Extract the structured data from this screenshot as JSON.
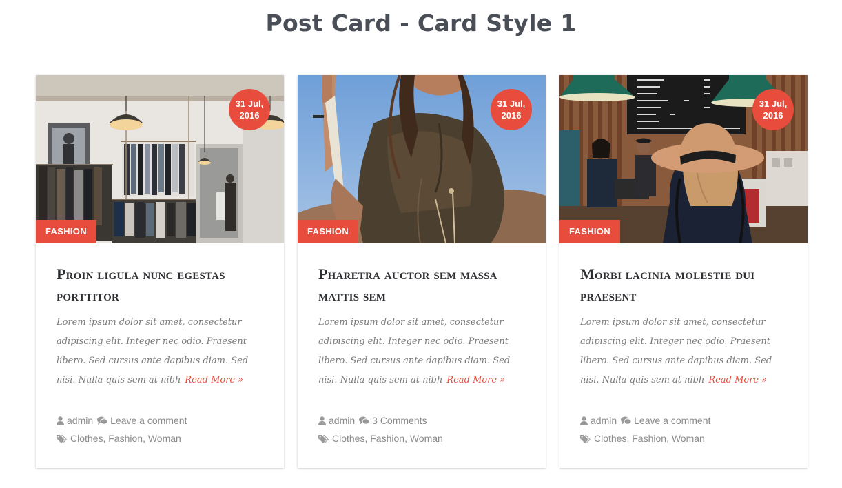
{
  "page": {
    "title": "Post Card - Card Style 1"
  },
  "colors": {
    "accent": "#e84c3d",
    "title": "#4a4e57",
    "text": "#7a7a7a"
  },
  "cards": [
    {
      "image": "clothing-store-photo",
      "date_line1": "31 Jul,",
      "date_line2": "2016",
      "category": "FASHION",
      "title": "Proin ligula nunc egestas porttitor",
      "excerpt": "Lorem ipsum dolor sit amet, consectetur adipiscing elit. Integer nec odio. Praesent libero. Sed cursus ante dapibus diam. Sed nisi. Nulla quis sem at nibh",
      "read_more": "Read More »",
      "author": "admin",
      "comments": "Leave a comment",
      "tags": [
        "Clothes",
        "Fashion",
        "Woman"
      ]
    },
    {
      "image": "woman-portrait-photo",
      "date_line1": "31 Jul,",
      "date_line2": "2016",
      "category": "FASHION",
      "title": "Pharetra auctor sem massa mattis sem",
      "excerpt": "Lorem ipsum dolor sit amet, consectetur adipiscing elit. Integer nec odio. Praesent libero. Sed cursus ante dapibus diam. Sed nisi. Nulla quis sem at nibh",
      "read_more": "Read More »",
      "author": "admin",
      "comments": "3 Comments",
      "tags": [
        "Clothes",
        "Fashion",
        "Woman"
      ]
    },
    {
      "image": "coffee-shop-photo",
      "date_line1": "31 Jul,",
      "date_line2": "2016",
      "category": "FASHION",
      "title": "Morbi lacinia molestie dui praesent",
      "excerpt": "Lorem ipsum dolor sit amet, consectetur adipiscing elit. Integer nec odio. Praesent libero. Sed cursus ante dapibus diam. Sed nisi. Nulla quis sem at nibh",
      "read_more": "Read More »",
      "author": "admin",
      "comments": "Leave a comment",
      "tags": [
        "Clothes",
        "Fashion",
        "Woman"
      ]
    }
  ]
}
